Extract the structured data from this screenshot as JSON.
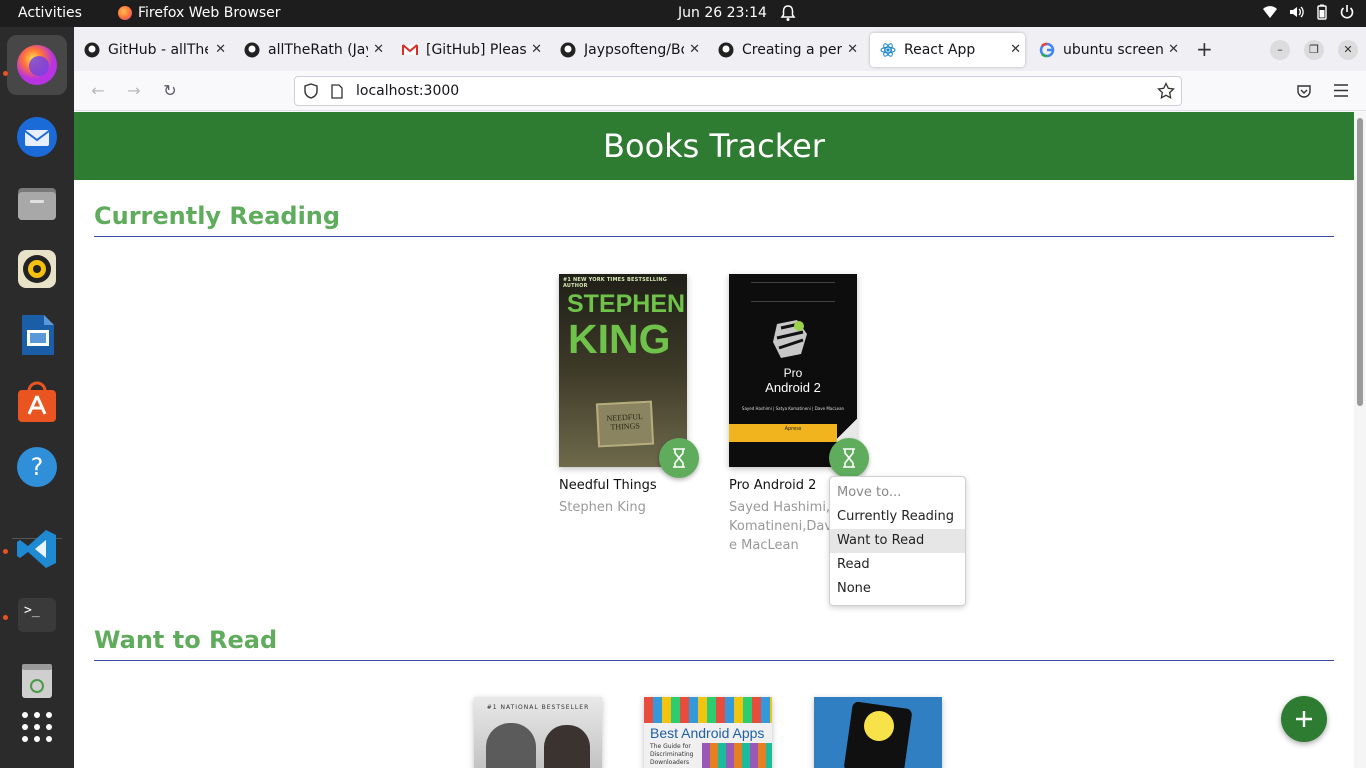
{
  "topbar": {
    "activities": "Activities",
    "app_name": "Firefox Web Browser",
    "clock": "Jun 26  23:14"
  },
  "dock": {
    "items": [
      "firefox",
      "thunderbird",
      "files",
      "rhythmbox",
      "libreoffice-impress",
      "app-center",
      "help",
      "vscode",
      "terminal",
      "trash",
      "show-apps"
    ]
  },
  "browser": {
    "tabs": [
      {
        "label": "GitHub - allTheRath"
      },
      {
        "label": "allTheRath (Jay"
      },
      {
        "label": "[GitHub] Please"
      },
      {
        "label": "Jaypsofteng/Bo"
      },
      {
        "label": "Creating a pers"
      },
      {
        "label": "React App"
      },
      {
        "label": "ubuntu screens"
      }
    ],
    "url": "localhost:3000"
  },
  "app": {
    "header_title": "Books Tracker",
    "shelves": [
      {
        "title": "Currently Reading"
      },
      {
        "title": "Want to Read"
      }
    ],
    "books": [
      {
        "title": "Needful Things",
        "authors": "Stephen King",
        "cover_texts": [
          "#1 NEW YORK TIMES BESTSELLING AUTHOR",
          "STEPHEN",
          "KING",
          "NEEDFUL",
          "THINGS"
        ]
      },
      {
        "title": "Pro Android 2",
        "authors": "Sayed Hashimi, Komatineni,Dave MacLean",
        "cover_texts": [
          "Pro",
          "Android 2",
          "Sayed Hashimi | Satya Komatineni | Dave MacLean",
          "Apress"
        ]
      }
    ],
    "want_covers": [
      {
        "cover_text": "#1 NATIONAL BESTSELLER"
      },
      {
        "cover_text": "Best Android Apps",
        "cover_subtext": "The Guide for Discriminating Downloaders"
      },
      {
        "cover_text": ""
      }
    ],
    "shelf_menu": {
      "header": "Move to...",
      "options": [
        "Currently Reading",
        "Want to Read",
        "Read",
        "None"
      ],
      "highlighted": "Want to Read"
    }
  },
  "colors": {
    "header_green": "#2e7c31",
    "shelf_title_green": "#60ac5d",
    "rule_blue": "#3a4aa0"
  }
}
